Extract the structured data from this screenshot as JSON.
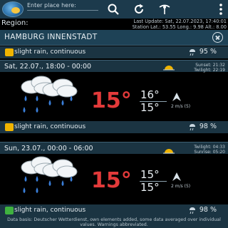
{
  "toolbar": {
    "place_placeholder": "Enter place here:",
    "icons": [
      "search-icon",
      "refresh-icon",
      "map-pin-icon",
      "menu-icon"
    ]
  },
  "region_label": "Region:",
  "last_update": "Last Update: Sat, 22.07.2023, 17:40:01",
  "station_coords": "Station Lat.: 53.55 Long.: 9.98 Alt.: 8.00",
  "station_name": "HAMBURG INNENSTADT",
  "current": {
    "description": "slight rain, continuous",
    "probability": "95 %",
    "warn_color": "#f0b400"
  },
  "forecasts": [
    {
      "date": "Sat, 22.07., 18:00 - 00:00",
      "sunset": "Sunset: 21:32",
      "twilight": "Twilight: 22:19",
      "temp_main": "15°",
      "temp_high": "16°",
      "temp_low": "15°",
      "wind": "2 m/s (5)",
      "description": "slight rain, continuous",
      "probability": "98 %",
      "warn_color": "#f0b400"
    },
    {
      "date": "Sun, 23.07., 00:00 - 06:00",
      "sunset": "Twilight: 04:33",
      "twilight": "Sunrise: 05:20",
      "temp_main": "15°",
      "temp_high": "15°",
      "temp_low": "15°",
      "wind": "2 m/s (5)",
      "description": "slight rain, continuous",
      "probability": "98 %",
      "warn_color": "#3fb23f"
    }
  ],
  "footer": "Data basis: Deutscher Wetterdienst, own elements added, some data averaged over individual values. Warnings abbreviated."
}
